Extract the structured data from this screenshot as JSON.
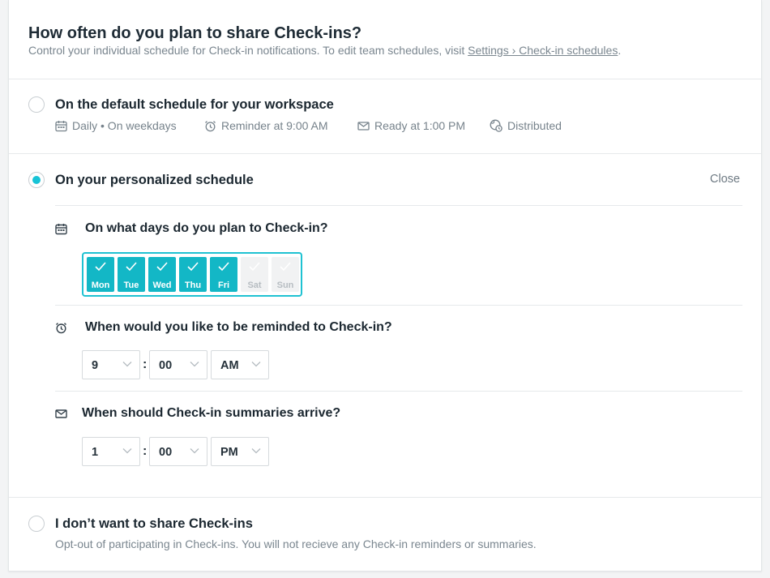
{
  "header": {
    "title": "How often do you plan to share Check-ins?",
    "subtitle_prefix": "Control your individual schedule for Check-in notifications. To edit team schedules, visit ",
    "subtitle_link": "Settings › Check-in schedules",
    "subtitle_suffix": "."
  },
  "options": {
    "default": {
      "title": "On the default schedule for your workspace",
      "meta": {
        "frequency": "Daily • On weekdays",
        "reminder": "Reminder at 9:00 AM",
        "ready": "Ready at 1:00 PM",
        "distribution": "Distributed"
      }
    },
    "personalized": {
      "title": "On your personalized schedule",
      "close_label": "Close",
      "days_question": "On what days do you plan to Check-in?",
      "days": [
        {
          "label": "Mon",
          "selected": true
        },
        {
          "label": "Tue",
          "selected": true
        },
        {
          "label": "Wed",
          "selected": true
        },
        {
          "label": "Thu",
          "selected": true
        },
        {
          "label": "Fri",
          "selected": true
        },
        {
          "label": "Sat",
          "selected": false
        },
        {
          "label": "Sun",
          "selected": false
        }
      ],
      "reminder_question": "When would you like to be reminded to Check-in?",
      "reminder_time": {
        "hour": "9",
        "minute": "00",
        "period": "AM"
      },
      "summary_question": "When should Check-in summaries arrive?",
      "summary_time": {
        "hour": "1",
        "minute": "00",
        "period": "PM"
      },
      "colon": ":"
    },
    "optout": {
      "title": "I don’t want to share Check-ins",
      "description": "Opt-out of participating in Check-ins. You will not recieve any Check-in reminders or summaries."
    }
  },
  "selected_option": "personalized",
  "colors": {
    "accent": "#13b7c6",
    "radio_dot": "#17c3d6",
    "day_border": "#1fc2d2"
  },
  "icons": {
    "frequency": "calendar-icon",
    "reminder": "alarm-clock-icon",
    "ready": "envelope-icon",
    "distribution": "globe-clock-icon",
    "check": "check-icon",
    "dropdown": "chevron-down-icon"
  }
}
